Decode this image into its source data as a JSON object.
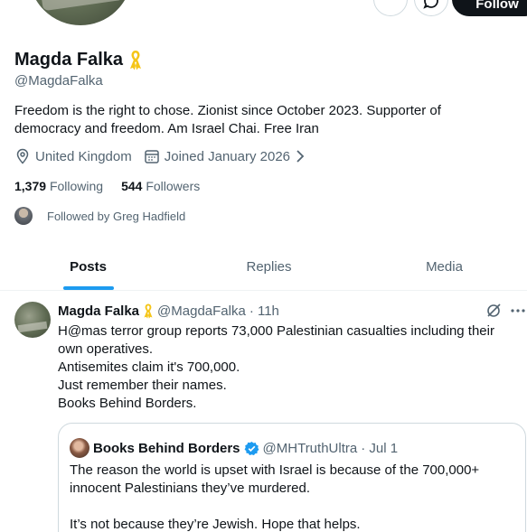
{
  "profile": {
    "display_name": "Magda Falka",
    "handle": "@MagdaFalka",
    "bio": "Freedom is the right to chose. Zionist since October 2023. Supporter of democracy and freedom. Am Israel Chai.  Free Iran",
    "location": "United Kingdom",
    "joined": "Joined January 2026",
    "following_count": "1,379",
    "following_label": "Following",
    "followers_count": "544",
    "followers_label": "Followers",
    "followed_by": "Followed by Greg Hadfield",
    "follow_button": "Follow",
    "ribbon_icon": "yellow-ribbon-icon",
    "ribbon_color": "#f5c518"
  },
  "tabs": [
    {
      "label": "Posts",
      "active": true
    },
    {
      "label": "Replies",
      "active": false
    },
    {
      "label": "Media",
      "active": false
    }
  ],
  "post": {
    "author_name": "Magda Falka",
    "author_handle": "@MagdaFalka",
    "time": "· 11h",
    "lines": [
      "H@mas terror group reports 73,000 Palestinian casualties including their own operatives.",
      "Antisemites claim it's 700,000.",
      "Just remember their names.",
      "Books Behind Borders."
    ],
    "quote": {
      "author_name": "Books Behind Borders",
      "author_handle": "@MHTruthUltra",
      "time": "· Jul 1",
      "verified_color": "#1d9bf0",
      "text_1": "The reason the world is upset with Israel is because of the 700,000+ innocent Palestinians they’ve murdered.",
      "text_2": "It’s not because they’re Jewish. Hope that helps."
    }
  },
  "colors": {
    "accent": "#1d9bf0",
    "text_primary": "#0f1419",
    "text_secondary": "#536471"
  }
}
